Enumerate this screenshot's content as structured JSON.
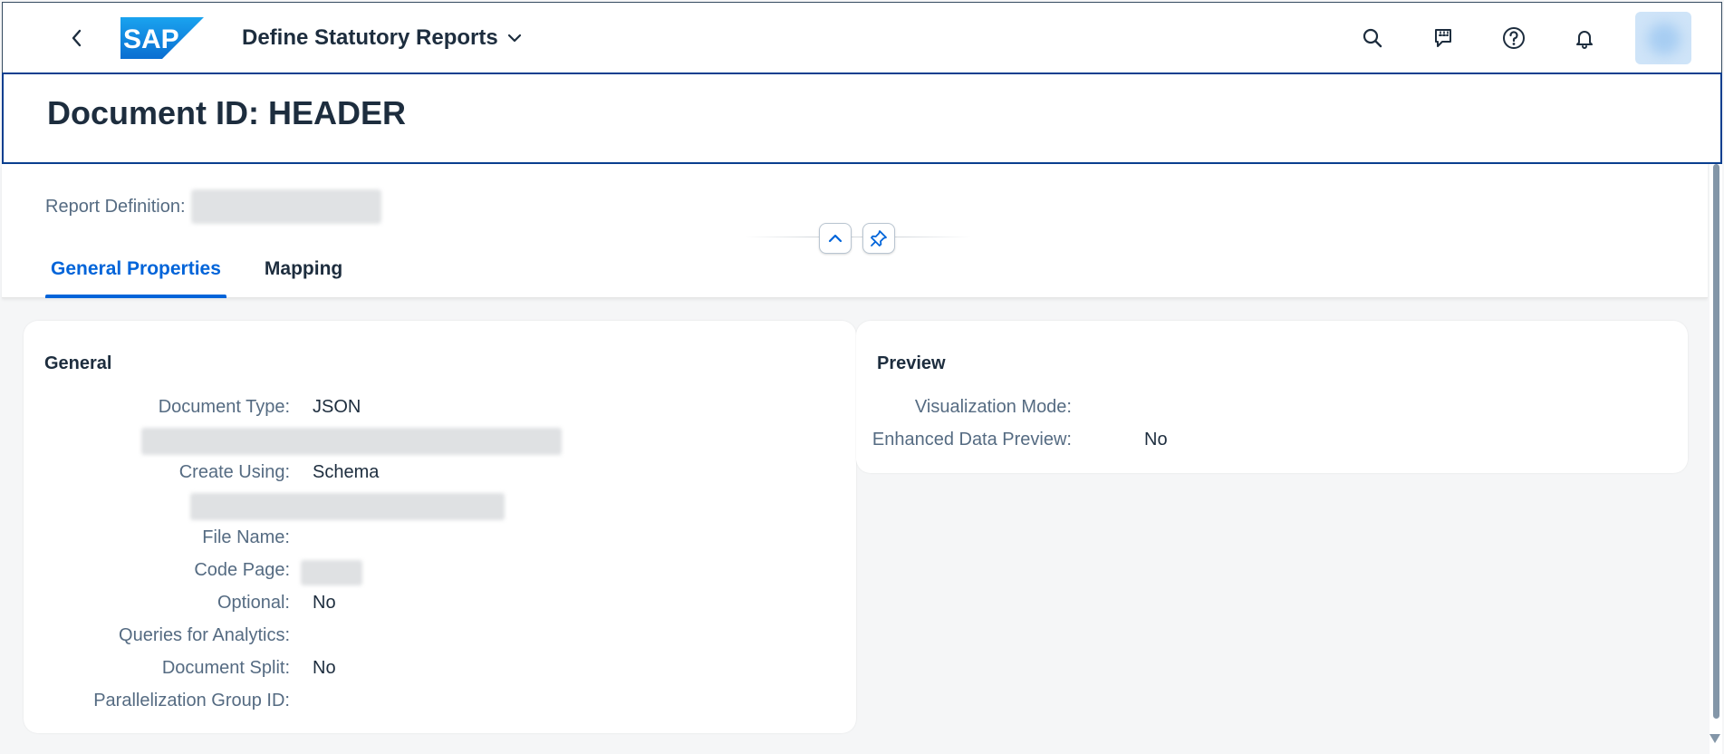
{
  "shell": {
    "app_title": "Define Statutory Reports",
    "logo_text": "SAP",
    "icons": [
      "back-icon",
      "search-icon",
      "feedback-icon",
      "help-icon",
      "notification-bell-icon"
    ]
  },
  "object_header": {
    "title": "Document ID: HEADER"
  },
  "header_content": {
    "report_definition_label": "Report Definition:"
  },
  "tabs": [
    {
      "label": "General Properties",
      "active": true
    },
    {
      "label": "Mapping",
      "active": false
    }
  ],
  "general": {
    "title": "General",
    "fields": [
      {
        "label": "Document Type:",
        "value": "JSON"
      },
      {
        "label": "Create Using:",
        "value": "Schema"
      },
      {
        "label": "File Name:",
        "value": ""
      },
      {
        "label": "Code Page:",
        "value": ""
      },
      {
        "label": "Optional:",
        "value": "No"
      },
      {
        "label": "Queries for Analytics:",
        "value": ""
      },
      {
        "label": "Document Split:",
        "value": "No"
      },
      {
        "label": "Parallelization Group ID:",
        "value": ""
      }
    ]
  },
  "preview": {
    "title": "Preview",
    "fields": [
      {
        "label": "Visualization Mode:",
        "value": ""
      },
      {
        "label": "Enhanced Data Preview:",
        "value": "No"
      }
    ]
  },
  "colors": {
    "brand_blue": "#0064d9",
    "header_border": "#0a3f8f",
    "label": "#556b82",
    "text": "#1d2d3e"
  }
}
